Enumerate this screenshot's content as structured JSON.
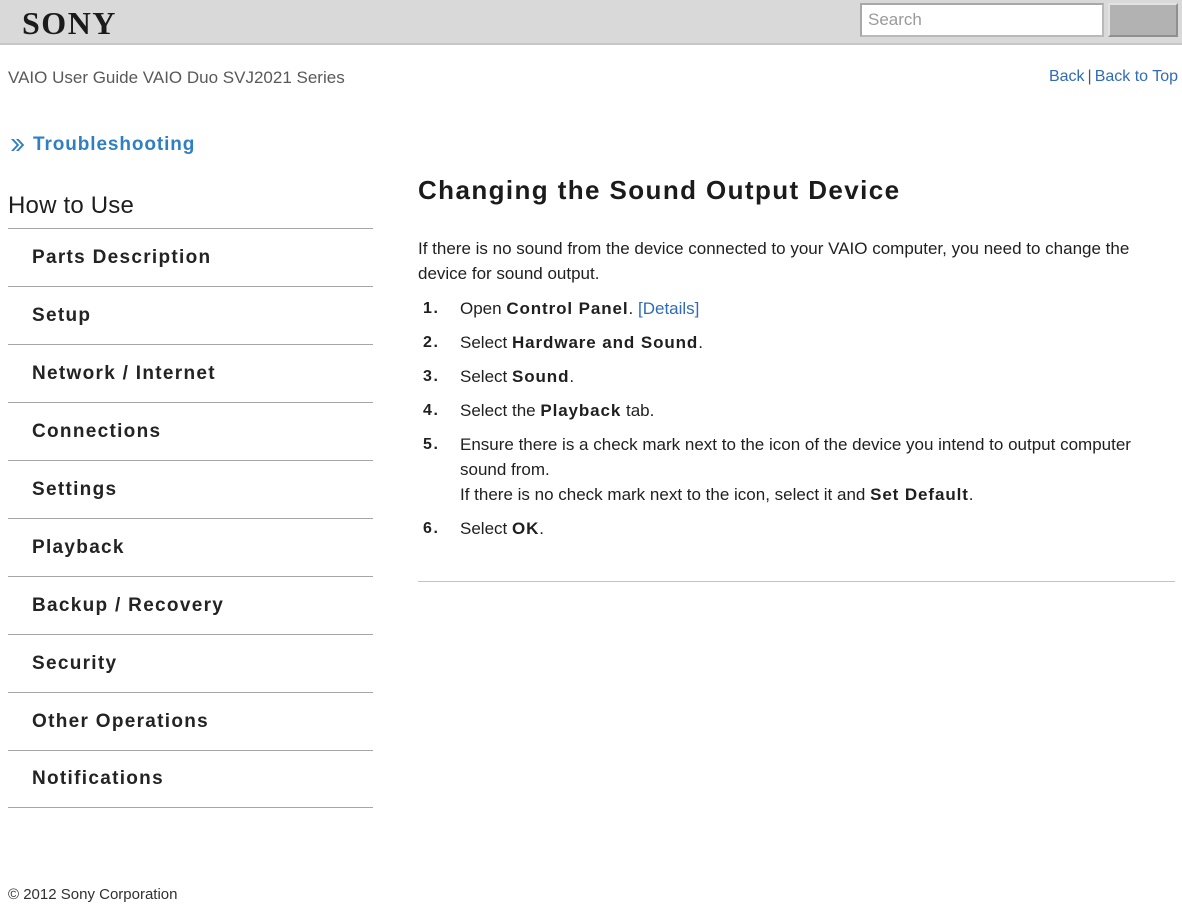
{
  "header": {
    "logo_text": "SONY",
    "search": {
      "placeholder": "Search",
      "value": "",
      "button_label": ""
    }
  },
  "title_row": {
    "guide_title": "VAIO User Guide VAIO Duo SVJ2021 Series",
    "back_link": "Back",
    "separator": "|",
    "back_to_top_link": "Back to Top"
  },
  "sidebar": {
    "breadcrumb": {
      "icon": "double-chevron-right-icon",
      "label": "Troubleshooting",
      "color": "#2f7fc4"
    },
    "section_title": "How to Use",
    "items": [
      {
        "label": "Parts Description"
      },
      {
        "label": "Setup"
      },
      {
        "label": "Network / Internet"
      },
      {
        "label": "Connections"
      },
      {
        "label": "Settings"
      },
      {
        "label": "Playback"
      },
      {
        "label": "Backup / Recovery"
      },
      {
        "label": "Security"
      },
      {
        "label": "Other Operations"
      },
      {
        "label": "Notifications"
      }
    ]
  },
  "content": {
    "heading": "Changing the Sound Output Device",
    "intro": "If there is no sound from the device connected to your VAIO computer, you need to change the device for sound output.",
    "steps": [
      {
        "num": "1.",
        "parts": [
          {
            "type": "text",
            "text": "Open "
          },
          {
            "type": "bold",
            "text": "Control Panel"
          },
          {
            "type": "text",
            "text": ". "
          },
          {
            "type": "link",
            "text": "[Details]"
          }
        ]
      },
      {
        "num": "2.",
        "parts": [
          {
            "type": "text",
            "text": "Select "
          },
          {
            "type": "bold",
            "text": "Hardware and Sound"
          },
          {
            "type": "text",
            "text": "."
          }
        ]
      },
      {
        "num": "3.",
        "parts": [
          {
            "type": "text",
            "text": "Select "
          },
          {
            "type": "bold",
            "text": "Sound"
          },
          {
            "type": "text",
            "text": "."
          }
        ]
      },
      {
        "num": "4.",
        "parts": [
          {
            "type": "text",
            "text": "Select the "
          },
          {
            "type": "bold",
            "text": "Playback"
          },
          {
            "type": "text",
            "text": " tab."
          }
        ]
      },
      {
        "num": "5.",
        "parts": [
          {
            "type": "text",
            "text": "Ensure there is a check mark next to the icon of the device you intend to output computer sound from."
          },
          {
            "type": "break"
          },
          {
            "type": "text",
            "text": "If there is no check mark next to the icon, select it and "
          },
          {
            "type": "bold",
            "text": "Set Default"
          },
          {
            "type": "text",
            "text": "."
          }
        ]
      },
      {
        "num": "6.",
        "parts": [
          {
            "type": "text",
            "text": "Select "
          },
          {
            "type": "bold",
            "text": "OK"
          },
          {
            "type": "text",
            "text": "."
          }
        ]
      }
    ]
  },
  "footer": {
    "copyright": "© 2012 Sony Corporation"
  }
}
